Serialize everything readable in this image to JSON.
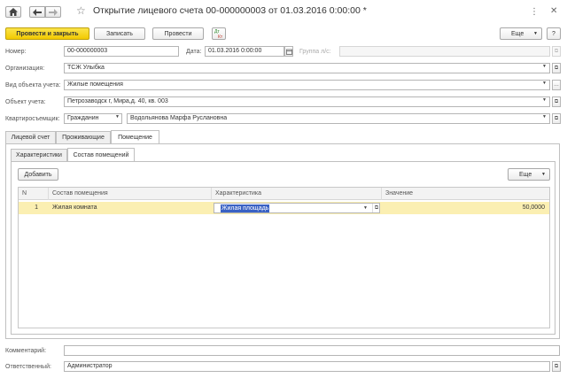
{
  "window": {
    "title": "Открытие лицевого счета 00-000000003 от 01.03.2016 0:00:00 *"
  },
  "toolbar": {
    "post_close": "Провести и закрыть",
    "write": "Записать",
    "post": "Провести",
    "more": "Еще",
    "help": "?"
  },
  "header": {
    "number_label": "Номер:",
    "number_value": "00-000000003",
    "date_label": "Дата:",
    "date_value": "01.03.2016  0:00:00",
    "group_label": "Группа л/с:",
    "group_value": ""
  },
  "fields": {
    "org_label": "Организация:",
    "org_value": "ТСЖ Улыбка",
    "object_type_label": "Вид объекта учета:",
    "object_type_value": "Жилые помещения",
    "object_label": "Объект учета:",
    "object_value": "Петрозаводск г, Мира,д. 40, кв. 003",
    "tenant_label": "Квартиросъемщик:",
    "tenant_type_value": "Гражданин",
    "tenant_value": "Водольянова Марфа Руслановна",
    "comment_label": "Комментарий:",
    "comment_value": "",
    "responsible_label": "Ответственный:",
    "responsible_value": "Администратор"
  },
  "tabs": [
    {
      "label": "Лицевой счет"
    },
    {
      "label": "Проживающие"
    },
    {
      "label": "Помещение"
    }
  ],
  "subtabs": [
    {
      "label": "Характеристики"
    },
    {
      "label": "Состав помещений"
    }
  ],
  "table": {
    "add_button": "Добавить",
    "more_button": "Еще",
    "columns": [
      "N",
      "Состав помещения",
      "Характеристика",
      "Значение"
    ],
    "rows": [
      {
        "n": "1",
        "room": "Жилая комната",
        "characteristic": "Жилая площадь",
        "value": "50,0000"
      }
    ]
  },
  "icons": {
    "home": "home-icon",
    "back": "arrow-left-icon",
    "forward": "arrow-right-icon",
    "star": "star-icon",
    "dt_kt": "dt-kt-icon",
    "calendar": "calendar-icon",
    "open": "open-link-icon"
  },
  "dt_kt_text": {
    "top": "Дт",
    "bottom": "Кт"
  }
}
